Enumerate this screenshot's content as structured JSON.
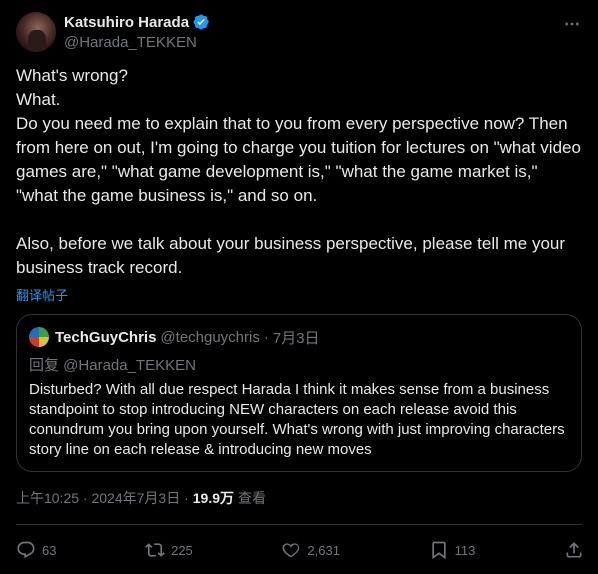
{
  "author": {
    "display_name": "Katsuhiro Harada",
    "handle": "@Harada_TEKKEN"
  },
  "body": {
    "line1": "What's wrong?",
    "line2": "What.",
    "para1": "Do you need me to explain that to you from every perspective now? Then from here on out, I'm going to charge you tuition for lectures on \"what video games are,\" \"what game development is,\" \"what the game market is,\" \"what the game business is,\" and so on.",
    "para2": "Also, before we talk about your business perspective, please tell me your business track record."
  },
  "translate_label": "翻译帖子",
  "quote": {
    "display_name": "TechGuyChris",
    "handle": "@techguychris",
    "separator": "·",
    "date": "7月3日",
    "reply_to": "回复 @Harada_TEKKEN",
    "text": "Disturbed? With all due respect Harada I think it makes sense from a business standpoint to stop introducing NEW characters on each release avoid this conundrum you bring upon yourself. What's wrong with just improving characters story line on each release & introducing new moves"
  },
  "meta": {
    "timestamp": "上午10:25 · 2024年7月3日 ·",
    "views_count": "19.9万",
    "views_label": "查看"
  },
  "actions": {
    "replies": "63",
    "retweets": "225",
    "likes": "2,631",
    "bookmarks": "113"
  },
  "icons": {
    "verified": "verified-badge-icon",
    "more": "more-options-icon",
    "reply": "reply-icon",
    "retweet": "retweet-icon",
    "like": "heart-icon",
    "bookmark": "bookmark-icon",
    "share": "share-icon"
  },
  "colors": {
    "background": "#000000",
    "text": "#e7e9ea",
    "secondary": "#71767b",
    "accent": "#1d9bf0",
    "border": "#2f3336"
  }
}
